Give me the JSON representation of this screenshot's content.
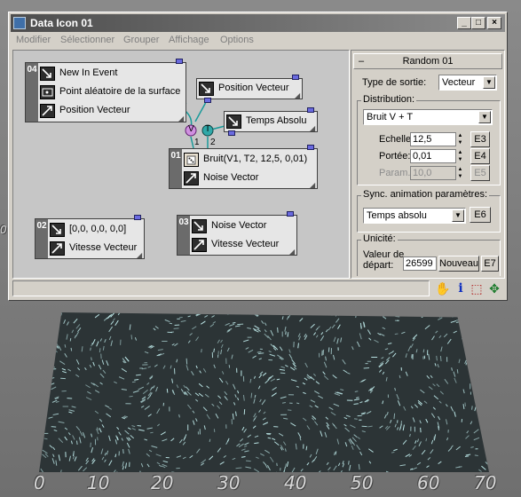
{
  "window": {
    "title": "Data Icon 01",
    "minimize": "_",
    "maximize": "□",
    "close": "×"
  },
  "menu": [
    "Modifier",
    "Sélectionner",
    "Grouper",
    "Affichage",
    "Options"
  ],
  "nodes": {
    "n04": {
      "num": "04",
      "rows": [
        "New In Event",
        "Point aléatoire de la surface",
        "Position Vecteur"
      ]
    },
    "nPos": {
      "rows": [
        "Position Vecteur"
      ]
    },
    "nTemps": {
      "rows": [
        "Temps Absolu"
      ]
    },
    "n01": {
      "num": "01",
      "rows": [
        "Bruit(V1, T2, 12,5, 0,01)",
        "Noise Vector"
      ]
    },
    "n02": {
      "num": "02",
      "rows": [
        "[0,0, 0,0, 0,0]",
        "Vitesse Vecteur"
      ]
    },
    "n03": {
      "num": "03",
      "rows": [
        "Noise Vector",
        "Vitesse Vecteur"
      ]
    },
    "ports": {
      "v": "V",
      "t": "T",
      "one": "1",
      "two": "2"
    }
  },
  "panel": {
    "rollout_title": "Random 01",
    "rollout_toggle": "–",
    "output_label": "Type de sortie:",
    "output_value": "Vecteur",
    "distribution_label": "Distribution:",
    "distribution_value": "Bruit V + T",
    "echelle_label": "Echelle:",
    "echelle_value": "12,5",
    "echelle_btn": "E3",
    "portee_label": "Portée:",
    "portee_value": "0,01",
    "portee_btn": "E4",
    "param3_label": "Param. 3:",
    "param3_value": "10,0",
    "param3_btn": "E5",
    "sync_label": "Sync. animation paramètres:",
    "sync_value": "Temps absolu",
    "sync_btn": "E6",
    "unicite_label": "Unicité:",
    "seed_label1": "Valeur de",
    "seed_label2": "départ:",
    "seed_value": "26599",
    "new_btn": "Nouveau",
    "new_btn_e": "E7"
  },
  "toolbar": {
    "hand": "✋",
    "info": "i",
    "select": "⬚",
    "move": "✥"
  },
  "viewport": {
    "left_tick": "0",
    "ticks": [
      "0",
      "10",
      "20",
      "30",
      "40",
      "50",
      "60",
      "70"
    ]
  },
  "colors": {
    "wire": "#1a9a9a",
    "port_v": "#d090e0",
    "port_t": "#30a8a8",
    "plug": "#6a6adf",
    "title_bar": "#4d4d4d"
  }
}
